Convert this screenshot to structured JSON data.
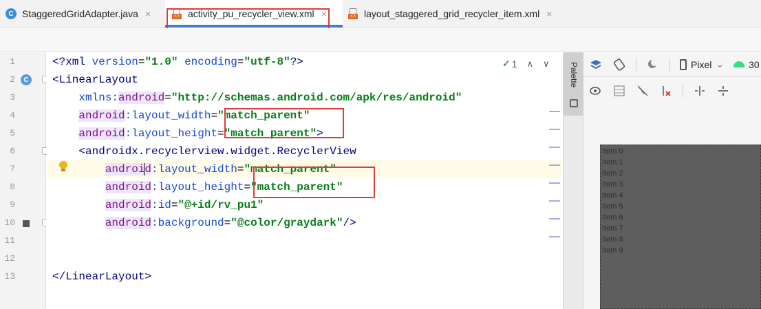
{
  "tabs": [
    {
      "label": "StaggeredGridAdapter.java",
      "icon": "java-class-icon",
      "active": false
    },
    {
      "label": "activity_pu_recycler_view.xml",
      "icon": "xml-file-icon",
      "active": true
    },
    {
      "label": "layout_staggered_grid_recycler_item.xml",
      "icon": "xml-file-icon",
      "active": false
    }
  ],
  "tab_close_glyph": "×",
  "gutter": {
    "line_numbers": [
      "1",
      "2",
      "3",
      "4",
      "5",
      "6",
      "7",
      "8",
      "9",
      "10",
      "11",
      "12",
      "13"
    ],
    "class_badge": "C"
  },
  "code": {
    "l1": {
      "a": "<?xml ",
      "b": "version",
      "c": "=",
      "d": "\"1.0\"",
      "e": " ",
      "f": "encoding",
      "g": "=",
      "h": "\"utf-8\"",
      "i": "?>"
    },
    "l2": {
      "a": "<LinearLayout"
    },
    "l3": {
      "a": "    ",
      "b": "xmlns:",
      "c": "android",
      "d": "=",
      "e": "\"http://schemas.android.com/apk/res/android\""
    },
    "l4": {
      "a": "    ",
      "b": "android",
      "c": ":layout_width",
      "d": "=",
      "e": "\"match_parent\""
    },
    "l5": {
      "a": "    ",
      "b": "android",
      "c": ":layout_height",
      "d": "=",
      "e": "\"match_parent\"",
      "f": ">"
    },
    "l6": {
      "a": "    <androidx.recyclerview.widget.RecyclerView"
    },
    "l7": {
      "a": "        ",
      "b": "androi",
      "b2": "d",
      "c": ":layout_width",
      "d": "=",
      "e": "\"match_parent\""
    },
    "l8": {
      "a": "        ",
      "b": "android",
      "c": ":layout_height",
      "d": "=",
      "e": "\"match_parent\""
    },
    "l9": {
      "a": "        ",
      "b": "android",
      "c": ":id",
      "d": "=",
      "e": "\"@+id/rv_pu1\""
    },
    "l10": {
      "a": "        ",
      "b": "android",
      "c": ":background",
      "d": "=",
      "e": "\"@color/graydark\"",
      "f": "/>"
    },
    "l13": {
      "a": "</LinearLayout>"
    }
  },
  "inspection": {
    "check": "✓",
    "count": "1",
    "up": "∧",
    "down": "∨"
  },
  "palette": {
    "label": "Palette"
  },
  "design_toolbar": {
    "device": "Pixel",
    "device_chevron": "⌄",
    "api": "30"
  },
  "preview_items": [
    "Item 0",
    "Item 1",
    "Item 2",
    "Item 3",
    "Item 4",
    "Item 5",
    "Item 6",
    "Item 7",
    "Item 8",
    "Item 9"
  ],
  "colors": {
    "accent": "#3f7fd0",
    "highlight_box": "#e03a3a",
    "xml_value": "#067d17",
    "xml_attr": "#174ad4",
    "xml_namespace": "#871094",
    "preview_bg": "#5e5e5e"
  }
}
